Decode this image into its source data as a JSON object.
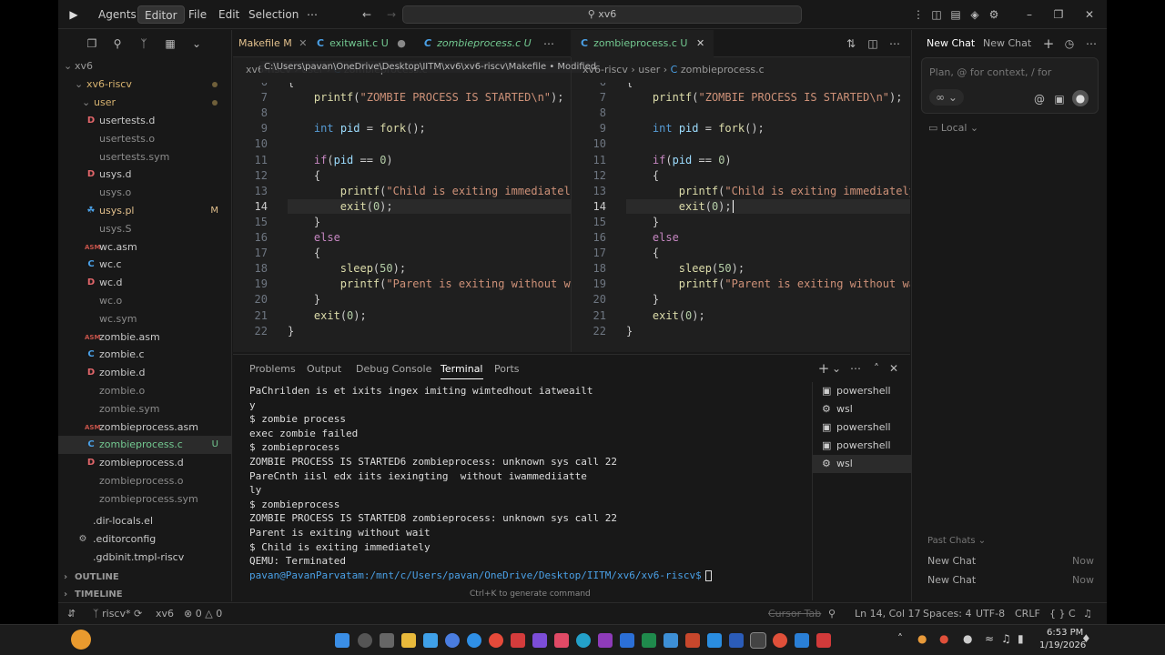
{
  "menu": {
    "items": [
      "Agents",
      "Editor",
      "File",
      "Edit",
      "Selection",
      "⋯"
    ],
    "search": "xv6"
  },
  "explorer": {
    "root": "xv6",
    "folder": "xv6-riscv",
    "subfolder": "user",
    "files": [
      {
        "icon": "D",
        "name": "usertests.d",
        "status": "",
        "color": "#e2666a"
      },
      {
        "icon": "",
        "name": "usertests.o",
        "status": "",
        "color": "#888"
      },
      {
        "icon": "",
        "name": "usertests.sym",
        "status": "",
        "color": "#888"
      },
      {
        "icon": "D",
        "name": "usys.d",
        "status": "",
        "color": "#e2666a"
      },
      {
        "icon": "",
        "name": "usys.o",
        "status": "",
        "color": "#888"
      },
      {
        "icon": "☘",
        "name": "usys.pl",
        "status": "M",
        "color": "#4aa0e6"
      },
      {
        "icon": "",
        "name": "usys.S",
        "status": "",
        "color": "#888"
      },
      {
        "icon": "ASM",
        "name": "wc.asm",
        "status": "",
        "color": "#c5534a"
      },
      {
        "icon": "C",
        "name": "wc.c",
        "status": "",
        "color": "#4aa0e6"
      },
      {
        "icon": "D",
        "name": "wc.d",
        "status": "",
        "color": "#e2666a"
      },
      {
        "icon": "",
        "name": "wc.o",
        "status": "",
        "color": "#888"
      },
      {
        "icon": "",
        "name": "wc.sym",
        "status": "",
        "color": "#888"
      },
      {
        "icon": "ASM",
        "name": "zombie.asm",
        "status": "",
        "color": "#c5534a"
      },
      {
        "icon": "C",
        "name": "zombie.c",
        "status": "",
        "color": "#4aa0e6"
      },
      {
        "icon": "D",
        "name": "zombie.d",
        "status": "",
        "color": "#e2666a"
      },
      {
        "icon": "",
        "name": "zombie.o",
        "status": "",
        "color": "#888"
      },
      {
        "icon": "",
        "name": "zombie.sym",
        "status": "",
        "color": "#888"
      },
      {
        "icon": "ASM",
        "name": "zombieprocess.asm",
        "status": "",
        "color": "#c5534a"
      },
      {
        "icon": "C",
        "name": "zombieprocess.c",
        "status": "U",
        "color": "#4aa0e6"
      },
      {
        "icon": "D",
        "name": "zombieprocess.d",
        "status": "",
        "color": "#e2666a"
      },
      {
        "icon": "",
        "name": "zombieprocess.o",
        "status": "",
        "color": "#888"
      },
      {
        "icon": "",
        "name": "zombieprocess.sym",
        "status": "",
        "color": "#888"
      }
    ],
    "dotfiles": [
      ".dir-locals.el",
      ".editorconfig",
      ".gdbinit.tmpl-riscv"
    ],
    "outline": "OUTLINE",
    "timeline": "TIMELINE"
  },
  "tabs_left": [
    {
      "name": "Makefile",
      "status": "M"
    },
    {
      "name": "exitwait.c",
      "status": "U"
    },
    {
      "name": "zombieprocess.c",
      "status": "U"
    }
  ],
  "tab_right": {
    "name": "zombieprocess.c",
    "status": "U"
  },
  "tooltip": "C:\\Users\\pavan\\OneDrive\\Desktop\\IITM\\xv6\\xv6-riscv\\Makefile • Modified",
  "crumb_left": [
    "xv6-riscv",
    "user",
    "zombieprocess.c"
  ],
  "crumb_right": [
    "xv6-riscv",
    "user",
    "zombieprocess.c"
  ],
  "code_lines": [
    {
      "n": "6",
      "t": "{"
    },
    {
      "n": "7",
      "t": "    printf(\"ZOMBIE PROCESS IS STARTED\\n\");"
    },
    {
      "n": "8",
      "t": ""
    },
    {
      "n": "9",
      "t": "    int pid = fork();"
    },
    {
      "n": "10",
      "t": ""
    },
    {
      "n": "11",
      "t": "    if(pid == 0)"
    },
    {
      "n": "12",
      "t": "    {"
    },
    {
      "n": "13",
      "t": "        printf(\"Child is exiting immediately\\"
    },
    {
      "n": "14",
      "t": "        exit(0);"
    },
    {
      "n": "15",
      "t": "    }"
    },
    {
      "n": "16",
      "t": "    else"
    },
    {
      "n": "17",
      "t": "    {"
    },
    {
      "n": "18",
      "t": "        sleep(50);"
    },
    {
      "n": "19",
      "t": "        printf(\"Parent is exiting without wai"
    },
    {
      "n": "20",
      "t": "    }"
    },
    {
      "n": "21",
      "t": "    exit(0);"
    },
    {
      "n": "22",
      "t": "}"
    }
  ],
  "panel_tabs": [
    "Problems",
    "Output",
    "Debug Console",
    "Terminal",
    "Ports"
  ],
  "terminal_lines": [
    "PaChrilden is et ixits ingex imiting wimtedhout iatweailt",
    "y",
    "$ zombie process",
    "exec zombie failed",
    "$ zombieprocess",
    "ZOMBIE PROCESS IS STARTED6 zombieprocess: unknown sys call 22",
    "PareCnth iisl edx iits iexingting  without iwammediiatte",
    "ly",
    "$ zombieprocess",
    "ZOMBIE PROCESS IS STARTED8 zombieprocess: unknown sys call 22",
    "Parent is exiting without wait",
    "$ Child is exiting immediately",
    "QEMU: Terminated"
  ],
  "prompt_user": "pavan@PavanParvatam",
  "prompt_path": ":/mnt/c/Users/pavan/OneDrive/Desktop/IITM/xv6/xv6-riscv$",
  "terminal_hint": "Ctrl+K to generate command",
  "terminals": [
    "powershell",
    "wsl",
    "powershell",
    "powershell",
    "wsl"
  ],
  "chat": {
    "tab_active": "New Chat",
    "tab_other": "New Chat",
    "placeholder": "Plan, @ for context, / for",
    "mode": "∞",
    "local": "Local",
    "past_label": "Past Chats",
    "past": [
      {
        "title": "New Chat",
        "time": "Now"
      },
      {
        "title": "New Chat",
        "time": "Now"
      }
    ]
  },
  "status": {
    "branch": "riscv*",
    "proj": "xv6",
    "errors": "0",
    "warnings": "0",
    "cursor_tab": "Cursor Tab",
    "position": "Ln 14, Col 17",
    "spaces": "Spaces: 4",
    "encoding": "UTF-8",
    "eol": "CRLF",
    "lang": "C"
  },
  "taskbar": {
    "time": "6:53 PM",
    "date": "1/19/2026"
  }
}
